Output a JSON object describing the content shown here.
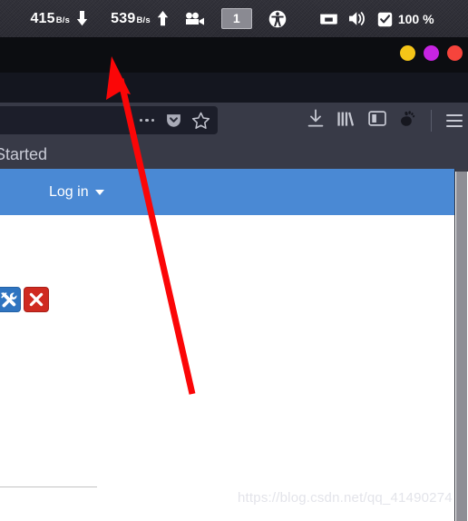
{
  "system_panel": {
    "download_speed": "415",
    "download_unit": "B/s",
    "upload_speed": "539",
    "upload_unit": "B/s",
    "download_arrow_icon": "arrow-down-icon",
    "upload_arrow_icon": "arrow-up-icon",
    "screencast_icon": "video-camera-icon",
    "workspace_indicator": "1",
    "accessibility_icon": "accessibility-icon",
    "network_icon": "wired-network-icon",
    "volume_icon": "volume-speaker-icon",
    "battery_icon": "battery-charged-icon",
    "battery_percent": "100 %"
  },
  "window_controls": {
    "minimize_label": "minimize",
    "maximize_label": "maximize",
    "close_label": "close",
    "minimize_color": "#f5c518",
    "maximize_color": "#c724e2",
    "close_color": "#f6443c"
  },
  "browser": {
    "urlbar": {
      "value": "",
      "placeholder": "",
      "page_actions_icon": "ellipsis-icon",
      "pocket_icon": "pocket-icon",
      "bookmark_icon": "star-outline-icon"
    },
    "toolbar_right": {
      "downloads_icon": "download-arrow-icon",
      "library_icon": "library-books-icon",
      "sidebar_icon": "sidebar-panel-icon",
      "extension_icon": "gnome-foot-icon",
      "menu_icon": "hamburger-menu-icon"
    },
    "bookmarks_bar": {
      "item_label": "Started"
    }
  },
  "page_content": {
    "site_nav": {
      "login_label": "Log in",
      "dropdown_icon": "chevron-down-icon",
      "background_color": "#4a89d4"
    },
    "action_buttons": [
      {
        "name": "tools-button",
        "icon": "wrench-screwdriver-icon",
        "color": "#2f74c0"
      },
      {
        "name": "close-button",
        "icon": "cross-x-icon",
        "color": "#cf2a20"
      }
    ],
    "watermark": "https://blog.csdn.net/qq_41490274"
  },
  "annotation": {
    "arrow_color": "#fb0607",
    "tail_x": "212",
    "tail_y": "434",
    "tip_x": "123",
    "tip_y": "62"
  }
}
